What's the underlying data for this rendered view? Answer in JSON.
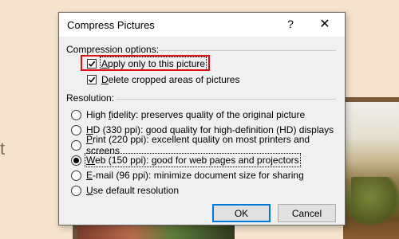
{
  "background": {
    "left_letter": "t"
  },
  "dialog": {
    "title": "Compress Pictures",
    "help_icon": "?",
    "close_icon": "✕",
    "compression": {
      "label": "Compression options:",
      "apply_only": {
        "prefix": "",
        "mnemonic": "A",
        "rest": "pply only to this picture",
        "checked": true
      },
      "delete_cropped": {
        "prefix": "",
        "mnemonic": "D",
        "rest": "elete cropped areas of pictures",
        "checked": true
      }
    },
    "resolution": {
      "label": "Resolution:",
      "options": [
        {
          "prefix": "High ",
          "mnemonic": "f",
          "rest": "idelity: preserves quality of the original picture",
          "selected": false
        },
        {
          "prefix": "",
          "mnemonic": "H",
          "rest": "D (330 ppi): good quality for high-definition (HD) displays",
          "selected": false
        },
        {
          "prefix": "",
          "mnemonic": "P",
          "rest": "rint (220 ppi): excellent quality on most printers and screens",
          "selected": false
        },
        {
          "prefix": "",
          "mnemonic": "W",
          "rest": "eb (150 ppi): good for web pages and projectors",
          "selected": true
        },
        {
          "prefix": "",
          "mnemonic": "E",
          "rest": "-mail (96 ppi): minimize document size for sharing",
          "selected": false
        },
        {
          "prefix": "",
          "mnemonic": "U",
          "rest": "se default resolution",
          "selected": false
        }
      ]
    },
    "buttons": {
      "ok": "OK",
      "cancel": "Cancel"
    }
  }
}
